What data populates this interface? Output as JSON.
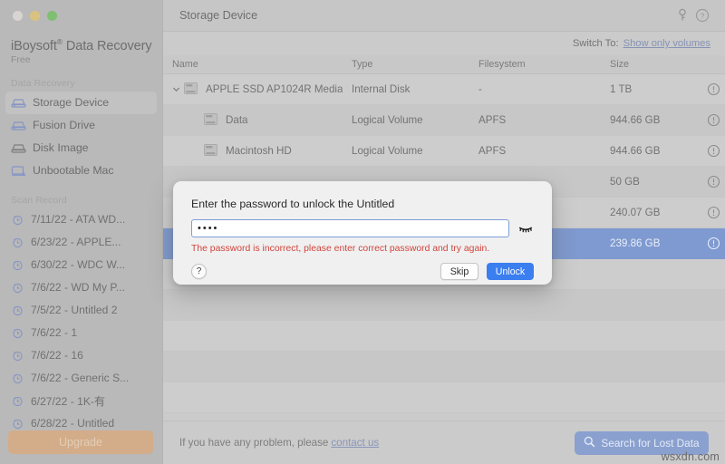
{
  "window": {
    "traffic_lights": [
      "close",
      "minimize",
      "maximize"
    ]
  },
  "sidebar": {
    "brand_name": "iBoysoft",
    "brand_registered": "®",
    "brand_suffix": " Data Recovery",
    "plan": "Free",
    "section_data_recovery": "Data Recovery",
    "section_scan_record": "Scan Record",
    "nav_items": [
      {
        "label": "Storage Device",
        "icon": "storage-device-icon",
        "active": true
      },
      {
        "label": "Fusion Drive",
        "icon": "fusion-drive-icon",
        "active": false
      },
      {
        "label": "Disk Image",
        "icon": "disk-image-icon",
        "active": false
      },
      {
        "label": "Unbootable Mac",
        "icon": "unbootable-mac-icon",
        "active": false
      }
    ],
    "scan_records": [
      {
        "label": "7/11/22 - ATA WD..."
      },
      {
        "label": "6/23/22 - APPLE..."
      },
      {
        "label": "6/30/22 - WDC W..."
      },
      {
        "label": "7/6/22 - WD My P..."
      },
      {
        "label": "7/5/22 - Untitled 2"
      },
      {
        "label": "7/6/22 - 1"
      },
      {
        "label": "7/6/22 - 16"
      },
      {
        "label": "7/6/22 - Generic S..."
      },
      {
        "label": "6/27/22 - 1K-有"
      },
      {
        "label": "6/28/22 - Untitled"
      }
    ],
    "upgrade_label": "Upgrade",
    "upgrade_color": "#d3ad8a"
  },
  "header": {
    "title": "Storage Device",
    "icons": [
      "key-icon",
      "help-circle-icon"
    ]
  },
  "switch_bar": {
    "label": "Switch To:",
    "link": "Show only volumes",
    "link_color": "#8693b6"
  },
  "table": {
    "columns": [
      "Name",
      "Type",
      "Filesystem",
      "Size"
    ],
    "rows": [
      {
        "name": "APPLE SSD AP1024R Media",
        "type": "Internal Disk",
        "filesystem": "-",
        "size": "1 TB",
        "level": 0,
        "expanded": true,
        "selected": false,
        "info_icon": "info-circle-icon"
      },
      {
        "name": "Data",
        "type": "Logical Volume",
        "filesystem": "APFS",
        "size": "944.66 GB",
        "level": 1,
        "expanded": false,
        "selected": false,
        "info_icon": "info-circle-icon"
      },
      {
        "name": "Macintosh HD",
        "type": "Logical Volume",
        "filesystem": "APFS",
        "size": "944.66 GB",
        "level": 1,
        "expanded": false,
        "selected": false,
        "info_icon": "info-circle-icon"
      },
      {
        "name": "",
        "type": "",
        "filesystem": "",
        "size": "50 GB",
        "level": 1,
        "expanded": false,
        "selected": false,
        "info_icon": "info-circle-icon"
      },
      {
        "name": "",
        "type": "",
        "filesystem": "",
        "size": "240.07 GB",
        "level": 1,
        "expanded": false,
        "selected": false,
        "info_icon": "info-circle-icon"
      },
      {
        "name": "",
        "type": "",
        "filesystem": "",
        "size": "239.86 GB",
        "level": 1,
        "expanded": false,
        "selected": true,
        "info_icon": "info-circle-icon"
      }
    ],
    "empty_row_count": 5,
    "selected_row_color": "#7f9ad0"
  },
  "dialog": {
    "title": "Enter the password to unlock the Untitled",
    "password_value": "••••",
    "password_placeholder": "",
    "eye_icon": "eye-closed-icon",
    "error_message": "The password is incorrect, please enter correct password and try again.",
    "error_color": "#d0443c",
    "help_label": "?",
    "skip_label": "Skip",
    "unlock_label": "Unlock",
    "unlock_color": "#3b7ef0"
  },
  "footer": {
    "text": "If you have any problem, please",
    "link": "contact us",
    "search_button_label": "Search for Lost Data",
    "search_icon": "magnifier-icon",
    "search_button_color": "#8aa0cf"
  },
  "watermark": {
    "text": "wsxdn.com"
  }
}
